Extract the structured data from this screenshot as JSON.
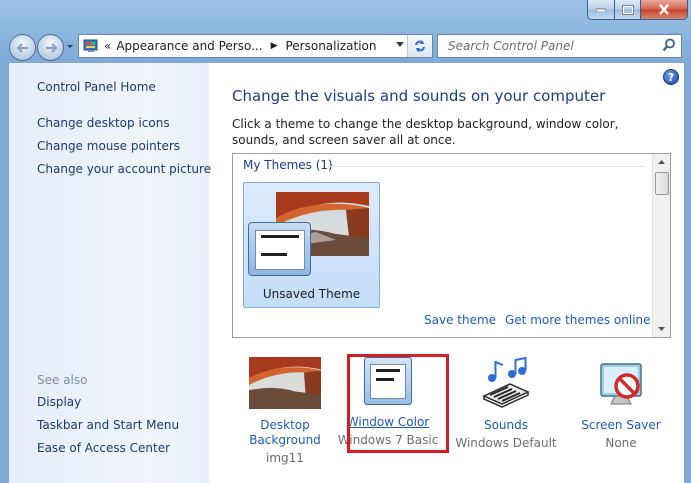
{
  "window": {
    "caption": {
      "minimize": "minimize",
      "maximize": "maximize",
      "close": "close"
    }
  },
  "nav": {
    "back": "back-icon",
    "forward": "forward-icon",
    "address": {
      "chevron": "«",
      "crumbs": [
        "Appearance and Perso...",
        "Personalization"
      ]
    },
    "search_placeholder": "Search Control Panel"
  },
  "sidebar": {
    "home": "Control Panel Home",
    "links": [
      "Change desktop icons",
      "Change mouse pointers",
      "Change your account picture"
    ],
    "see_also_label": "See also",
    "see_also": [
      "Display",
      "Taskbar and Start Menu",
      "Ease of Access Center"
    ]
  },
  "main": {
    "title": "Change the visuals and sounds on your computer",
    "description": "Click a theme to change the desktop background, window color, sounds, and screen saver all at once.",
    "themes": {
      "group_label": "My Themes (1)",
      "tiles": [
        {
          "label": "Unsaved Theme",
          "selected": true
        }
      ],
      "save_theme": "Save theme",
      "get_more": "Get more themes online"
    },
    "bottom": {
      "desktop_background": {
        "label": "Desktop Background",
        "value": "img11"
      },
      "window_color": {
        "label": "Window Color",
        "value": "Windows 7 Basic"
      },
      "sounds": {
        "label": "Sounds",
        "value": "Windows Default"
      },
      "screen_saver": {
        "label": "Screen Saver",
        "value": "None"
      }
    },
    "help": "?"
  },
  "colors": {
    "link": "#1b5cb8",
    "title": "#1e3b8b",
    "highlight": "#d51d24",
    "tile_selected": "#c4ddf9"
  }
}
